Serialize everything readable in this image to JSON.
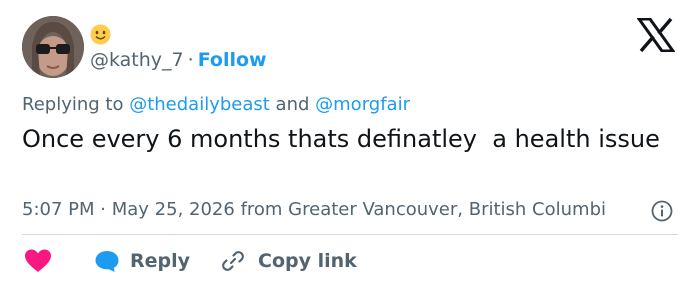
{
  "author": {
    "handle": "@kathy_7",
    "separator": "·",
    "follow_label": "Follow",
    "emoji": "smiling-face-emoji"
  },
  "reply_context": {
    "prefix": "Replying to ",
    "mention_1": "@thedailybeast",
    "conjunction": " and ",
    "mention_2": "@morgfair"
  },
  "tweet": {
    "text": "Once every 6 months thats definatley  a health issue"
  },
  "meta": {
    "time": "5:07 PM",
    "separator": "·",
    "date": "May 25, 2026",
    "location": "from Greater Vancouver, British Columbi"
  },
  "actions": {
    "reply_label": "Reply",
    "copy_link_label": "Copy link"
  },
  "icons": {
    "logo": "x-logo-icon",
    "info": "info-icon",
    "like": "heart-icon",
    "reply": "speech-bubble-icon",
    "link": "link-icon"
  },
  "colors": {
    "accent": "#1d9bf0",
    "text": "#0f1419",
    "secondary_text": "#536471",
    "like": "#f91880",
    "divider": "#cfd9de"
  }
}
